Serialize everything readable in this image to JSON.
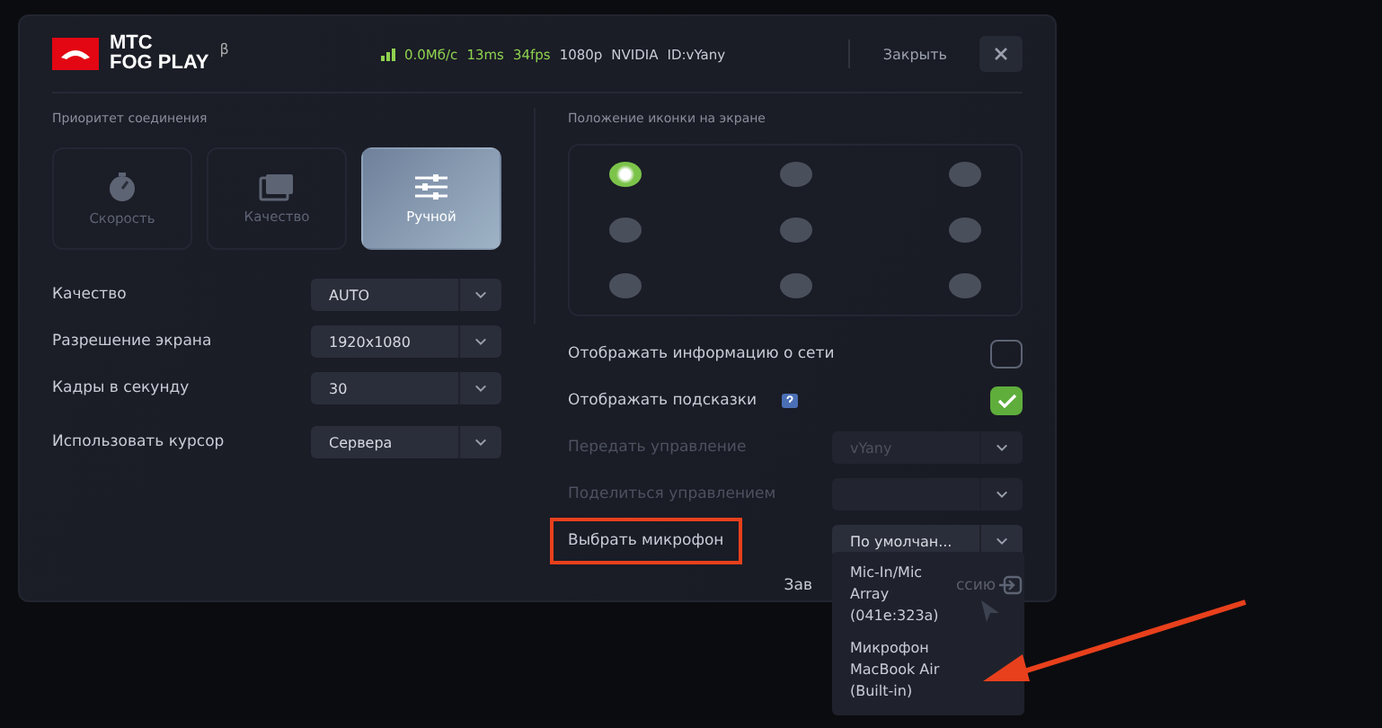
{
  "header": {
    "logo_line1": "МТС",
    "logo_line2": "FOG PLAY",
    "beta": "β",
    "stats": [
      {
        "text": "0.0Мб/с",
        "kind": "good"
      },
      {
        "text": "13ms",
        "kind": "good"
      },
      {
        "text": "34fps",
        "kind": "good"
      },
      {
        "text": "1080p",
        "kind": "info"
      },
      {
        "text": "NVIDIA",
        "kind": "info"
      },
      {
        "text": "ID:vYany",
        "kind": "info"
      }
    ],
    "close_label": "Закрыть"
  },
  "priority": {
    "title": "Приоритет соединения",
    "options": [
      {
        "label": "Скорость",
        "kind": "speed",
        "selected": false
      },
      {
        "label": "Качество",
        "kind": "quality",
        "selected": false
      },
      {
        "label": "Ручной",
        "kind": "manual",
        "selected": true
      }
    ]
  },
  "settings": [
    {
      "label": "Качество",
      "value": "AUTO"
    },
    {
      "label": "Разрешение экрана",
      "value": "1920x1080"
    },
    {
      "label": "Кадры в секунду",
      "value": "30"
    },
    {
      "label": "Использовать курсор",
      "value": "Сервера"
    }
  ],
  "icon_position": {
    "title": "Положение иконки на экране",
    "spots": [
      {
        "selected": true
      },
      {
        "selected": false
      },
      {
        "selected": false
      },
      {
        "selected": false
      },
      {
        "selected": false
      },
      {
        "selected": false
      },
      {
        "selected": false
      },
      {
        "selected": false
      },
      {
        "selected": false
      }
    ]
  },
  "options": [
    {
      "kind": "toggle",
      "label": "Отображать информацию о сети",
      "checked": false,
      "help": false
    },
    {
      "kind": "toggle",
      "label": "Отображать подсказки",
      "checked": true,
      "help": true
    },
    {
      "kind": "select",
      "label": "Передать управление",
      "value": "vYany",
      "disabled": true,
      "highlighted": false
    },
    {
      "kind": "select",
      "label": "Поделиться управлением",
      "disabled": true,
      "highlighted": false
    },
    {
      "kind": "select",
      "label": "Выбрать микрофон",
      "value": "По умолчан...",
      "disabled": false,
      "highlighted": true
    }
  ],
  "end_session": {
    "visible_start": "Зав",
    "visible_end": "ссию"
  },
  "microphone_menu": [
    {
      "label": "Mic-In/Mic Array (041e:323a)"
    },
    {
      "label": "Микрофон MacBook Air (Built-in)"
    }
  ]
}
